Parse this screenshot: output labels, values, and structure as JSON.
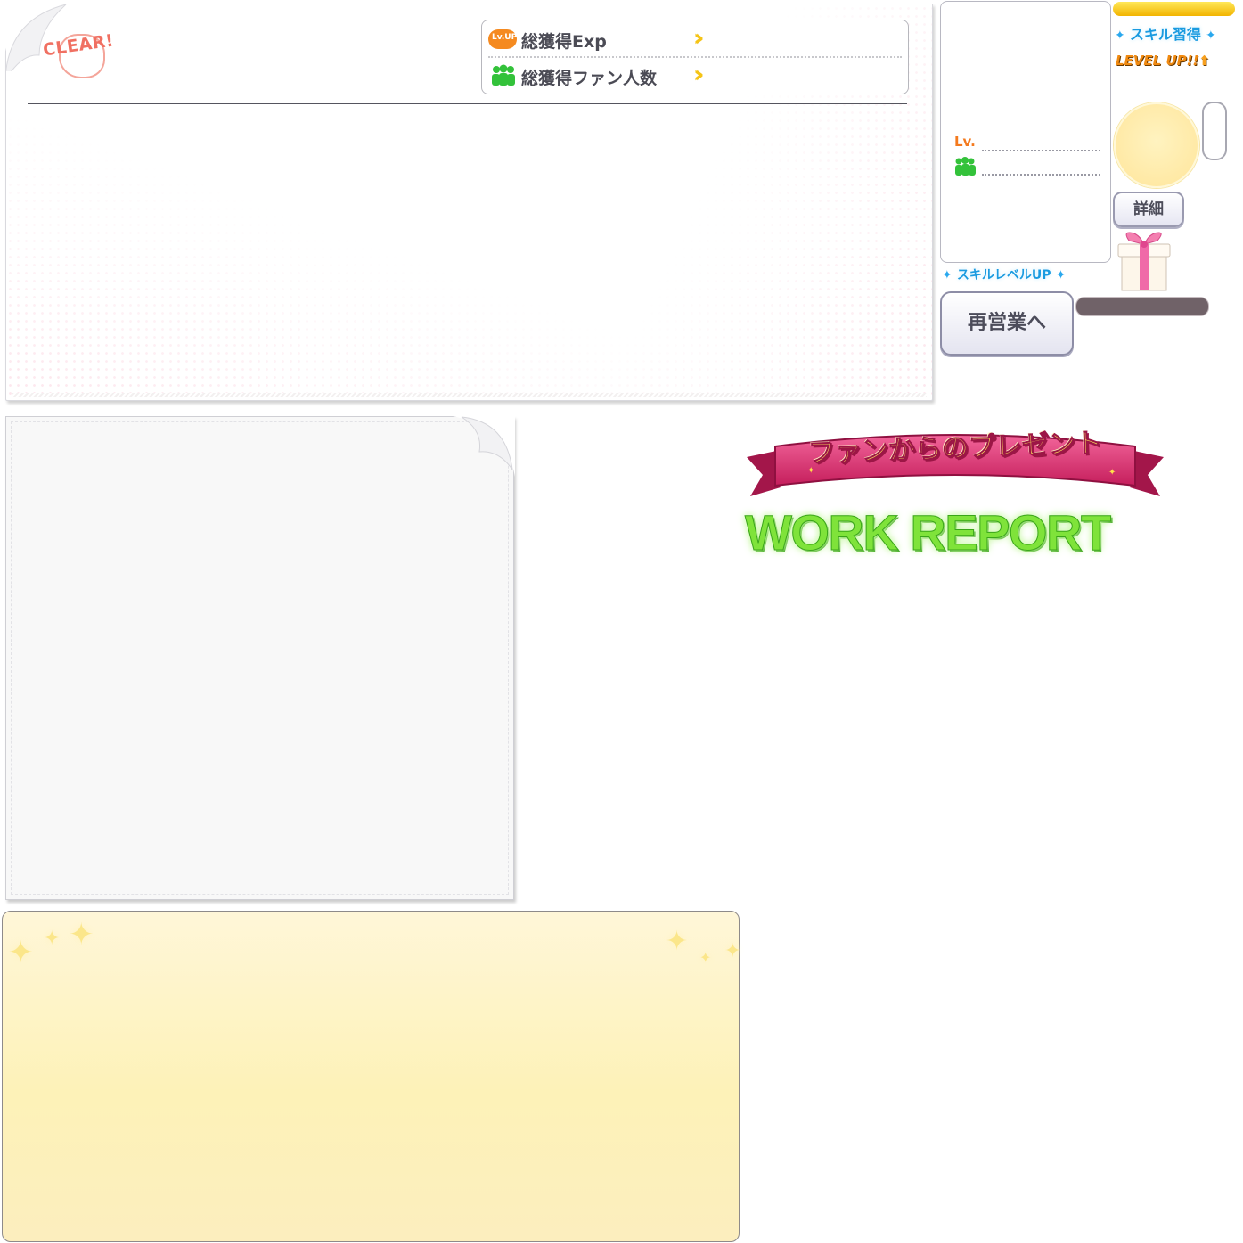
{
  "result_panel": {
    "clear_stamp": "CLEAR!",
    "stats": [
      {
        "icon": "lv-up-icon",
        "badge": "Lv.UP",
        "label": "総獲得Exp"
      },
      {
        "icon": "fans-icon",
        "label": "総獲得ファン人数"
      }
    ]
  },
  "chara_box": {
    "lv_label": "Lv."
  },
  "skill_acquired_label": "スキル習得",
  "level_up_label": "LEVEL UP!!",
  "detail_button": "詳細",
  "skill_level_up_label": "スキルレベルUP",
  "reopen_button": "再営業へ",
  "present_banner": {
    "ribbon_text": "ファンからのプレゼント",
    "title": "WORK REPORT"
  },
  "colors": {
    "orange_accent": "#f47a1e",
    "green_fans": "#33c23a",
    "chevron_yellow": "#f5c417",
    "blue_sparkle": "#1a9be0",
    "ribbon_pink": "#d8306e",
    "work_report_green": "#7fe33a"
  }
}
